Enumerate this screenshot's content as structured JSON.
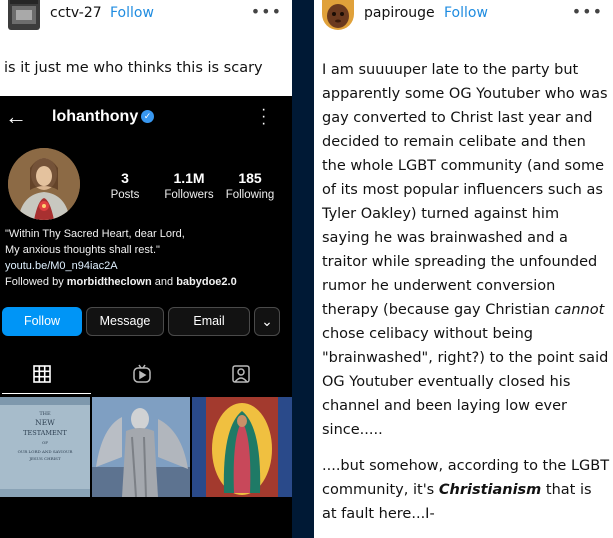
{
  "left_post": {
    "username": "cctv-27",
    "follow_label": "Follow",
    "more_label": "•••",
    "caption": "is it just me who thinks this is scary",
    "instagram": {
      "back_label": "←",
      "handle": "lohanthony",
      "verified_label": "✓",
      "stats": [
        {
          "value": "3",
          "label": "Posts"
        },
        {
          "value": "1.1M",
          "label": "Followers"
        },
        {
          "value": "185",
          "label": "Following"
        }
      ],
      "bio_line1": "\"Within Thy Sacred Heart, dear Lord,",
      "bio_line2": "My anxious thoughts shall rest.\"",
      "bio_link": "youtu.be/M0_n94iac2A",
      "followed_prefix": "Followed by ",
      "followed_user1": "morbidtheclown",
      "followed_and": " and ",
      "followed_user2": "babydoe2.0",
      "buttons": {
        "follow": "Follow",
        "message": "Message",
        "email": "Email",
        "dropdown": "⌄"
      },
      "tiles": [
        {
          "line1": "THE",
          "line2": "NEW",
          "line3": "TESTAMENT",
          "line4": "OF",
          "line5": "OUR LORD AND SAVIOUR",
          "line6": "JESUS CHRIST"
        }
      ]
    }
  },
  "right_post": {
    "username": "papirouge",
    "follow_label": "Follow",
    "more_label": "•••",
    "para1_a": "I am suuuuper late to the party but apparently some OG Youtuber who was gay converted to Christ last year and decided to remain celibate and then the whole LGBT community (and some of its most popular influencers such as Tyler Oakley) turned against him saying he was brainwashed and a traitor while spreading the unfounded rumor he underwent conversion therapy (because gay Christian ",
    "para1_em": "cannot",
    "para1_b": " chose celibacy without being \"brainwashed\", right?) to the point said OG Youtuber eventually closed his channel and been laying low ever since.....",
    "para2_a": "....but somehow, according to the LGBT community, it's ",
    "para2_strong": "Christianism",
    "para2_b": " that is at fault here...I-"
  },
  "colors": {
    "background": "#001935",
    "tumblr_link": "#1f8ce0",
    "instagram_blue": "#0095f6"
  }
}
